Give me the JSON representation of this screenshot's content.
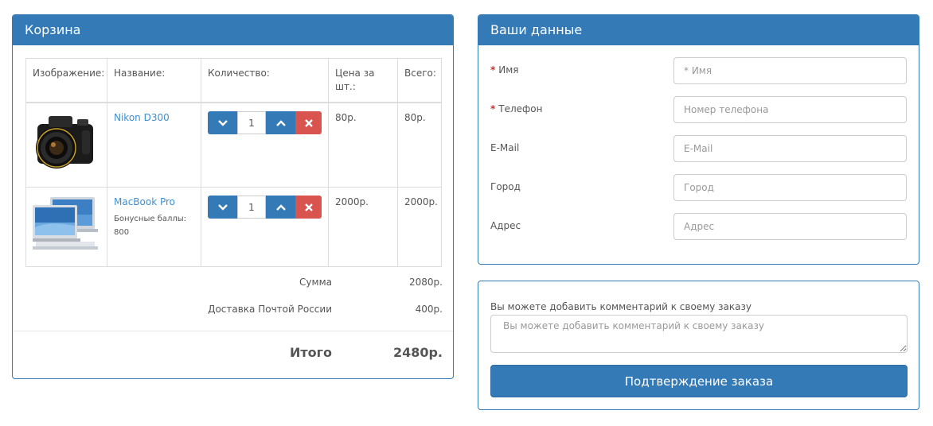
{
  "cart": {
    "title": "Корзина",
    "headers": {
      "image": "Изображение:",
      "name": "Название:",
      "quantity": "Количество:",
      "price": "Цена за шт.:",
      "total": "Всего:"
    },
    "items": [
      {
        "name": "Nikon D300",
        "bonus": "",
        "quantity": "1",
        "price": "80р.",
        "total": "80р."
      },
      {
        "name": "MacBook Pro",
        "bonus": "Бонусные баллы: 800",
        "quantity": "1",
        "price": "2000р.",
        "total": "2000р."
      }
    ],
    "subtotal_label": "Сумма",
    "subtotal_value": "2080р.",
    "shipping_label": "Доставка Почтой России",
    "shipping_value": "400р.",
    "grand_total_label": "Итого",
    "grand_total_value": "2480р."
  },
  "user": {
    "title": "Ваши данные",
    "fields": [
      {
        "label": "Имя",
        "required": true,
        "placeholder": "* Имя"
      },
      {
        "label": "Телефон",
        "required": true,
        "placeholder": "Номер телефона"
      },
      {
        "label": "E-Mail",
        "required": false,
        "placeholder": "E-Mail"
      },
      {
        "label": "Город",
        "required": false,
        "placeholder": "Город"
      },
      {
        "label": "Адрес",
        "required": false,
        "placeholder": "Адрес"
      }
    ],
    "required_mark": "*"
  },
  "comment": {
    "label": "Вы можете добавить комментарий к своему заказу",
    "placeholder": "Вы можете добавить комментарий к своему заказу",
    "confirm_label": "Подтверждение заказа"
  },
  "colors": {
    "primary": "#337ab7",
    "danger": "#d9534f",
    "link": "#3f8fd0",
    "required": "#c9302c"
  },
  "icons": {
    "decrease": "chevron-down-icon",
    "increase": "chevron-up-icon",
    "remove": "remove-x-icon"
  }
}
